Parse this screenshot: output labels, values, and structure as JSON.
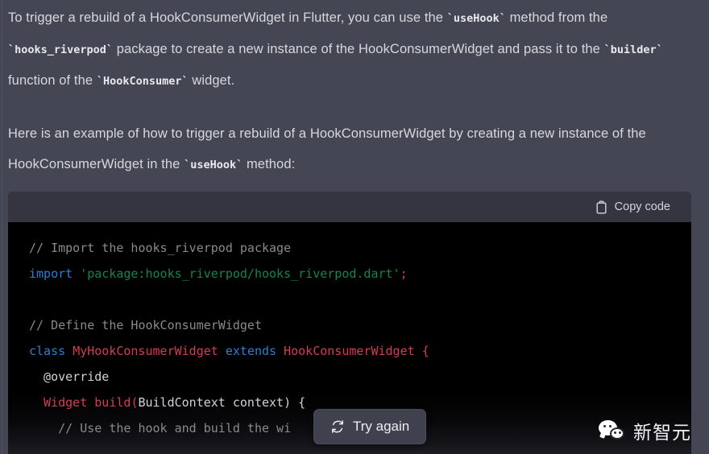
{
  "theme": {
    "page_background": "#444654",
    "code_header_background": "#343541",
    "code_body_background": "#000000",
    "button_background": "#40414f",
    "text_color": "#d6d8dd",
    "comment_color": "#8a8a8a",
    "keyword_color": "#2a7fd4",
    "string_color": "#12864a",
    "class_color": "#d43d51"
  },
  "message": {
    "paragraph_1": {
      "segments": [
        {
          "type": "text",
          "value": "To trigger a rebuild of a HookConsumerWidget in Flutter, you can use the "
        },
        {
          "type": "code",
          "value": "`useHook`"
        },
        {
          "type": "text",
          "value": " method from the "
        },
        {
          "type": "code",
          "value": "`hooks_riverpod`"
        },
        {
          "type": "text",
          "value": " package to create a new instance of the HookConsumerWidget and pass it to the "
        },
        {
          "type": "code",
          "value": "`builder`"
        },
        {
          "type": "text",
          "value": " function of the "
        },
        {
          "type": "code",
          "value": "`HookConsumer`"
        },
        {
          "type": "text",
          "value": " widget."
        }
      ],
      "t1": "To trigger a rebuild of a HookConsumerWidget in Flutter, you can use the ",
      "c1": "`useHook`",
      "t2": " method from the ",
      "c2": "`hooks_riverpod`",
      "t3": " package to create a new instance of the HookConsumerWidget and pass it to the ",
      "c3": "`builder`",
      "t4": " function of the ",
      "c4": "`HookConsumer`",
      "t5": " widget."
    },
    "paragraph_2": {
      "t1": "Here is an example of how to trigger a rebuild of a HookConsumerWidget by creating a new instance of the HookConsumerWidget in the ",
      "c1": "`useHook`",
      "t2": " method:"
    }
  },
  "code_block": {
    "copy_label": "Copy code",
    "copy_icon": "clipboard-icon",
    "language": "dart",
    "lines": [
      {
        "tokens": [
          {
            "t": "comment",
            "v": "// Import the hooks_riverpod package"
          }
        ]
      },
      {
        "tokens": [
          {
            "t": "keyword",
            "v": "import"
          },
          {
            "t": "plain",
            "v": " "
          },
          {
            "t": "string",
            "v": "'package:hooks_riverpod/hooks_riverpod.dart'"
          },
          {
            "t": "punct",
            "v": ";"
          }
        ]
      },
      {
        "tokens": [
          {
            "t": "plain",
            "v": ""
          }
        ]
      },
      {
        "tokens": [
          {
            "t": "comment",
            "v": "// Define the HookConsumerWidget"
          }
        ]
      },
      {
        "tokens": [
          {
            "t": "keyword",
            "v": "class"
          },
          {
            "t": "plain",
            "v": " "
          },
          {
            "t": "class",
            "v": "MyHookConsumerWidget"
          },
          {
            "t": "plain",
            "v": " "
          },
          {
            "t": "keyword",
            "v": "extends"
          },
          {
            "t": "plain",
            "v": " "
          },
          {
            "t": "class",
            "v": "HookConsumerWidget"
          },
          {
            "t": "plain",
            "v": " "
          },
          {
            "t": "punct",
            "v": "{"
          }
        ]
      },
      {
        "tokens": [
          {
            "t": "plain",
            "v": "  @override"
          }
        ]
      },
      {
        "tokens": [
          {
            "t": "plain",
            "v": "  "
          },
          {
            "t": "class",
            "v": "Widget"
          },
          {
            "t": "plain",
            "v": " "
          },
          {
            "t": "class",
            "v": "build"
          },
          {
            "t": "punct",
            "v": "("
          },
          {
            "t": "plain",
            "v": "BuildContext context) {"
          }
        ]
      },
      {
        "tokens": [
          {
            "t": "comment",
            "v": "    // Use the hook and build the wi"
          }
        ]
      }
    ]
  },
  "try_again_button": {
    "label": "Try again",
    "icon": "refresh-icon"
  },
  "watermark": {
    "text": "新智元",
    "icon": "wechat-icon"
  }
}
